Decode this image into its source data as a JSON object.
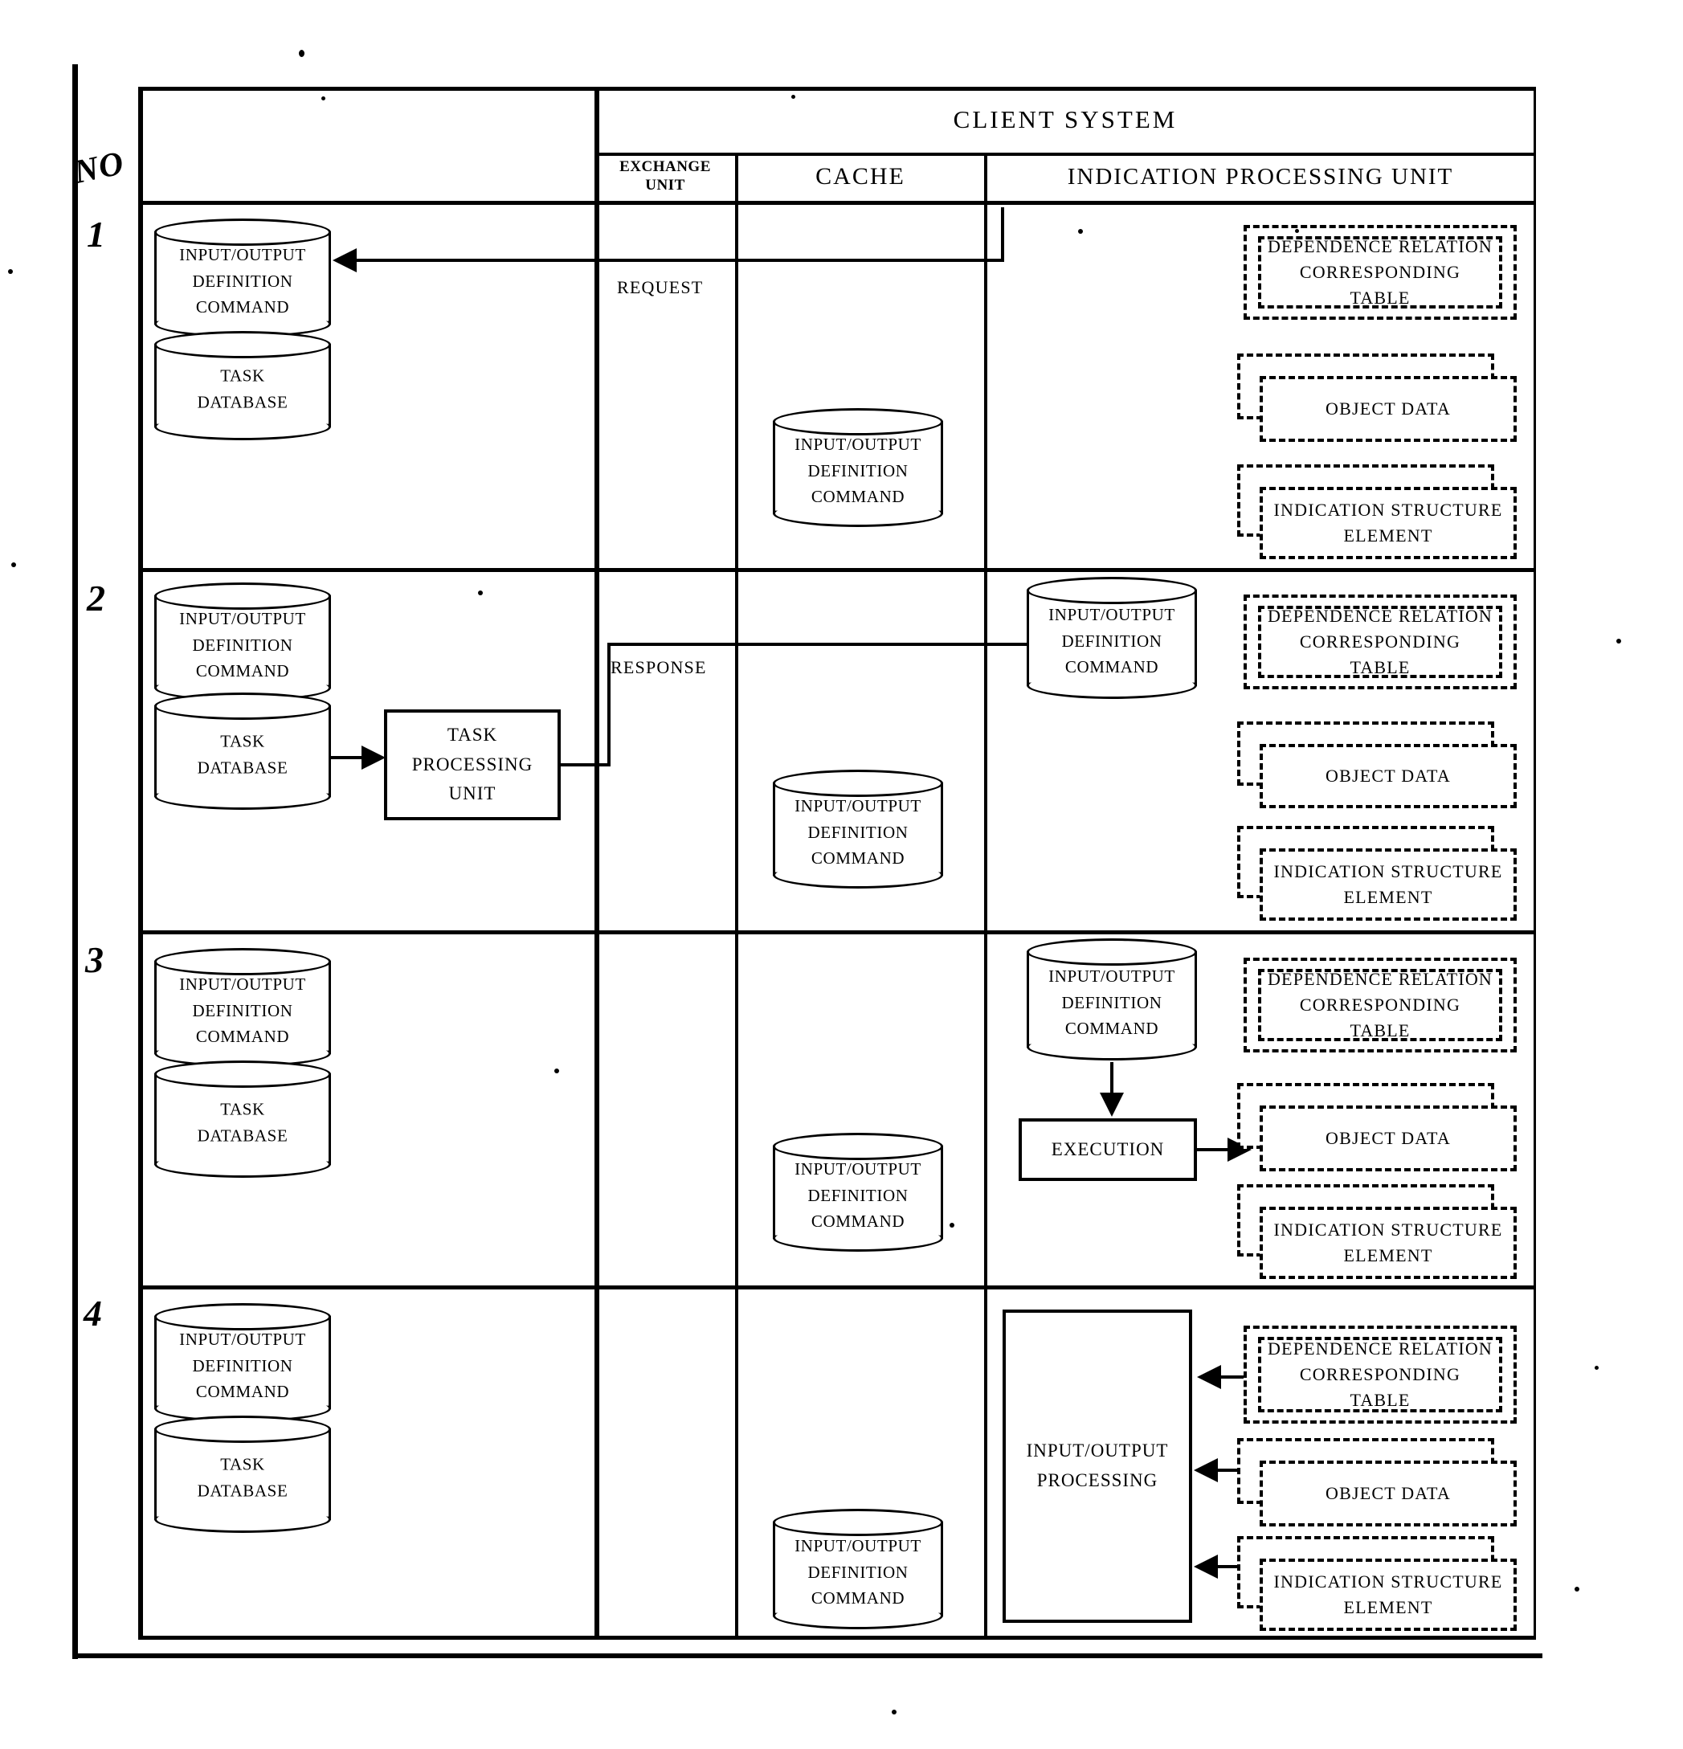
{
  "figure": {
    "type": "patent-sequence-table",
    "no_column_header": "NO",
    "client_system_header": "CLIENT SYSTEM",
    "columns": [
      {
        "key": "no",
        "label": "NO"
      },
      {
        "key": "server",
        "label": ""
      },
      {
        "key": "exchange",
        "label": "EXCHANGE\nUNIT",
        "line1": "EXCHANGE",
        "line2": "UNIT"
      },
      {
        "key": "cache",
        "label": "CACHE"
      },
      {
        "key": "indication",
        "label": "INDICATION  PROCESSING  UNIT"
      }
    ],
    "labels": {
      "io_def_cmd_l1": "INPUT/OUTPUT",
      "io_def_cmd_l2": "DEFINITION",
      "io_def_cmd_l3": "COMMAND",
      "task_db_l1": "TASK",
      "task_db_l2": "DATABASE",
      "task_proc_l1": "TASK",
      "task_proc_l2": "PROCESSING",
      "task_proc_l3": "UNIT",
      "dep_rel_l1": "DEPENDENCE  RELATION",
      "dep_rel_l2": "CORRESPONDING",
      "dep_rel_l3": "TABLE",
      "object_data": "OBJECT  DATA",
      "ind_struct_l1": "INDICATION  STRUCTURE",
      "ind_struct_l2": "ELEMENT",
      "request": "REQUEST",
      "response": "RESPONSE",
      "execution": "EXECUTION",
      "io_processing_l1": "INPUT/OUTPUT",
      "io_processing_l2": "PROCESSING"
    },
    "rows": [
      {
        "number": "1",
        "server_cylinders": [
          "io_def_cmd",
          "task_db"
        ],
        "exchange_label": "REQUEST",
        "cache_cylinders": [
          "io_def_cmd"
        ],
        "indication_boxes": [
          "dep_rel",
          "object_data",
          "ind_struct"
        ],
        "indication_cylinder": null,
        "arrows": [
          "request-left-into-io-def-cmd"
        ]
      },
      {
        "number": "2",
        "server_cylinders": [
          "io_def_cmd",
          "task_db"
        ],
        "exchange_label": "RESPONSE",
        "cache_cylinders": [
          "io_def_cmd"
        ],
        "indication_boxes": [
          "dep_rel",
          "object_data",
          "ind_struct"
        ],
        "indication_cylinder": "io_def_cmd",
        "solid_box": "task_processing_unit",
        "arrows": [
          "task-db-to-task-processing-unit",
          "response-right-into-indication-cylinder"
        ]
      },
      {
        "number": "3",
        "server_cylinders": [
          "io_def_cmd",
          "task_db"
        ],
        "exchange_label": "",
        "cache_cylinders": [
          "io_def_cmd"
        ],
        "indication_boxes": [
          "dep_rel",
          "object_data",
          "ind_struct"
        ],
        "indication_cylinder": "io_def_cmd",
        "solid_box": "execution",
        "arrows": [
          "indication-cylinder-down-to-execution",
          "execution-right-to-object-data"
        ]
      },
      {
        "number": "4",
        "server_cylinders": [
          "io_def_cmd",
          "task_db"
        ],
        "exchange_label": "",
        "cache_cylinders": [
          "io_def_cmd"
        ],
        "indication_boxes": [
          "dep_rel",
          "object_data",
          "ind_struct"
        ],
        "indication_cylinder": null,
        "solid_box": "io_processing",
        "arrows": [
          "dep-rel-left-to-io-processing",
          "object-data-bidirectional",
          "ind-struct-bidirectional"
        ]
      }
    ],
    "colors": {
      "ink": "#000000",
      "paper": "#ffffff"
    }
  }
}
